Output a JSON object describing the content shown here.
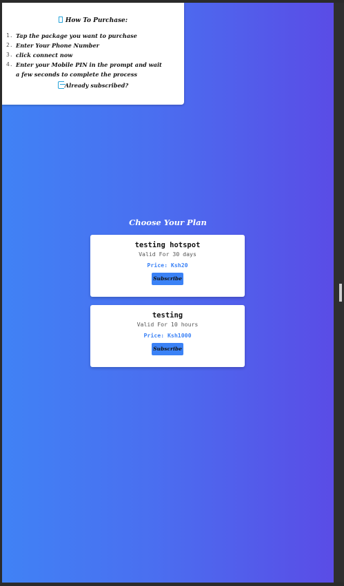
{
  "howto": {
    "title": "How To Purchase:",
    "steps": [
      {
        "num": "1.",
        "text": "Tap the package you want to purchase"
      },
      {
        "num": "2.",
        "text": "Enter Your Phone Number"
      },
      {
        "num": "3.",
        "text": "click connect now"
      },
      {
        "num": "4.",
        "text": "Enter your Mobile PIN in the prompt and wait a few seconds to complete the process"
      }
    ],
    "already_subscribed": "Already subscribed?"
  },
  "plans": {
    "heading": "Choose Your Plan",
    "items": [
      {
        "name": "testing hotspot",
        "validity": "Valid For 30 days",
        "price": "Price: Ksh20",
        "button": "Subscribe"
      },
      {
        "name": "testing",
        "validity": "Valid For 10 hours",
        "price": "Price: Ksh1000",
        "button": "Subscribe"
      }
    ]
  },
  "colors": {
    "gradient_start": "#4082f5",
    "gradient_end": "#5a4ce6",
    "accent": "#3b82f6",
    "icon": "#27a3d9"
  },
  "icons": {
    "title_icon": "info-icon",
    "already_icon": "login-icon"
  }
}
